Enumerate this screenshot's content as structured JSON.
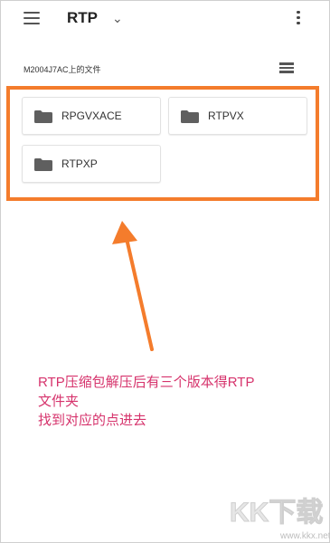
{
  "topbar": {
    "title": "RTP",
    "menu_icon": "hamburger-menu-icon",
    "dropdown_icon": "chevron-down-icon",
    "more_icon": "more-vert-icon"
  },
  "location": {
    "label": "M2004J7AC上的文件",
    "view_icon": "list-view-icon"
  },
  "folders": [
    {
      "name": "RPGVXACE",
      "icon": "folder-icon"
    },
    {
      "name": "RTPVX",
      "icon": "folder-icon"
    },
    {
      "name": "RTPXP",
      "icon": "folder-icon"
    }
  ],
  "annotation": {
    "line1": "RTP压缩包解压后有三个版本得RTP",
    "line2": "文件夹",
    "line3": "找到对应的点进去",
    "highlight_color": "#f47c2c",
    "text_color": "#d6336c"
  },
  "watermark": {
    "text": "KK下载",
    "url": "www.kkx.net"
  }
}
